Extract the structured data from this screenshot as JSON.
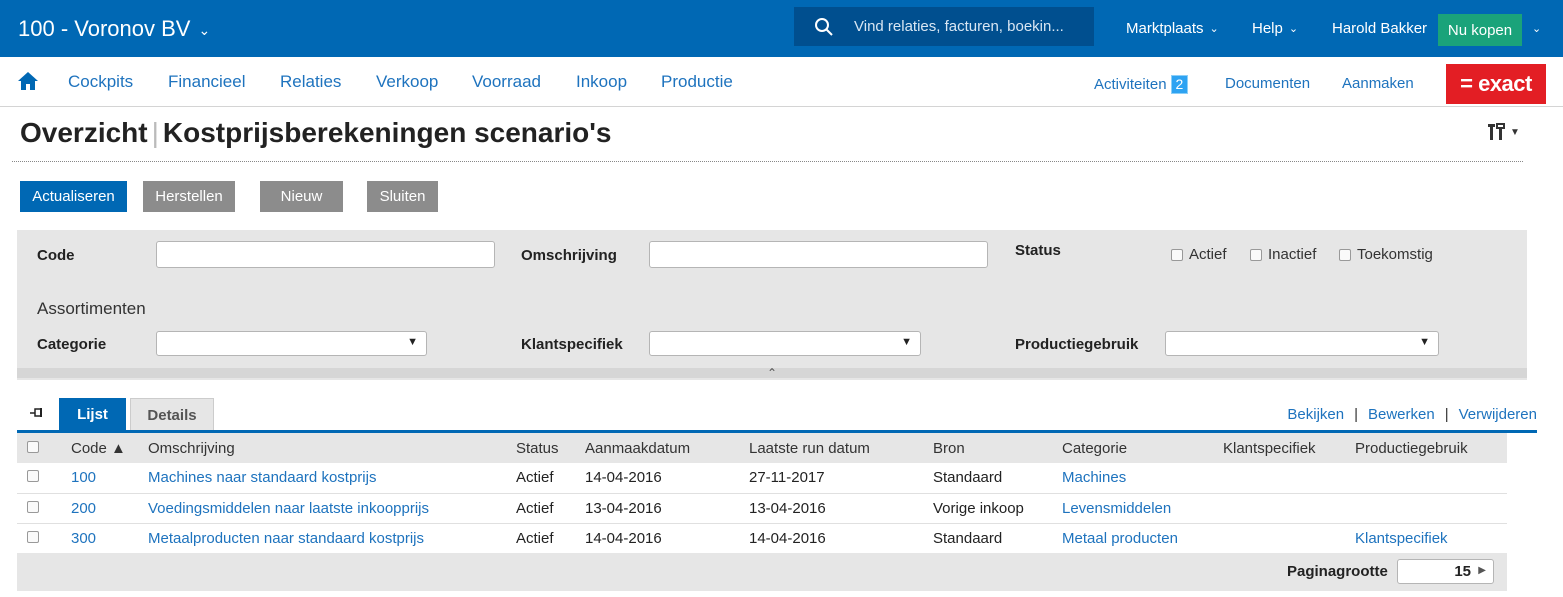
{
  "topbar": {
    "company": "100 - Voronov BV",
    "search_placeholder": "Vind relaties, facturen, boekin...",
    "marktplaats": "Marktplaats",
    "help": "Help",
    "user": "Harold Bakker",
    "buy": "Nu kopen"
  },
  "nav": {
    "items": [
      "Cockpits",
      "Financieel",
      "Relaties",
      "Verkoop",
      "Voorraad",
      "Inkoop",
      "Productie"
    ],
    "activiteiten": "Activiteiten",
    "activiteiten_count": "2",
    "documenten": "Documenten",
    "aanmaken": "Aanmaken",
    "logo": "= exact"
  },
  "page": {
    "title_a": "Overzicht",
    "title_b": "Kostprijsberekeningen scenario's"
  },
  "buttons": {
    "actualiseren": "Actualiseren",
    "herstellen": "Herstellen",
    "nieuw": "Nieuw",
    "sluiten": "Sluiten"
  },
  "filters": {
    "code_label": "Code",
    "code_value": "",
    "omschrijving_label": "Omschrijving",
    "omschrijving_value": "",
    "status_label": "Status",
    "status_options": [
      "Actief",
      "Inactief",
      "Toekomstig"
    ],
    "assortimenten": "Assortimenten",
    "categorie_label": "Categorie",
    "klantspecifiek_label": "Klantspecifiek",
    "productiegebruik_label": "Productiegebruik"
  },
  "tabs": {
    "lijst": "Lijst",
    "details": "Details"
  },
  "actions": {
    "bekijken": "Bekijken",
    "bewerken": "Bewerken",
    "verwijderen": "Verwijderen"
  },
  "table": {
    "headers": [
      "Code ▲",
      "Omschrijving",
      "Status",
      "Aanmaakdatum",
      "Laatste run datum",
      "Bron",
      "Categorie",
      "Klantspecifiek",
      "Productiegebruik"
    ],
    "rows": [
      [
        "100",
        "Machines naar standaard kostprijs",
        "Actief",
        "14-04-2016",
        "27-11-2017",
        "Standaard",
        "Machines",
        "",
        ""
      ],
      [
        "200",
        "Voedingsmiddelen naar laatste inkoopprijs",
        "Actief",
        "13-04-2016",
        "13-04-2016",
        "Vorige inkoop",
        "Levensmiddelen",
        "",
        ""
      ],
      [
        "300",
        "Metaalproducten naar standaard kostprijs",
        "Actief",
        "14-04-2016",
        "14-04-2016",
        "Standaard",
        "Metaal producten",
        "",
        "Klantspecifiek"
      ]
    ]
  },
  "footer": {
    "page_size_label": "Paginagrootte",
    "page_size": "15"
  }
}
